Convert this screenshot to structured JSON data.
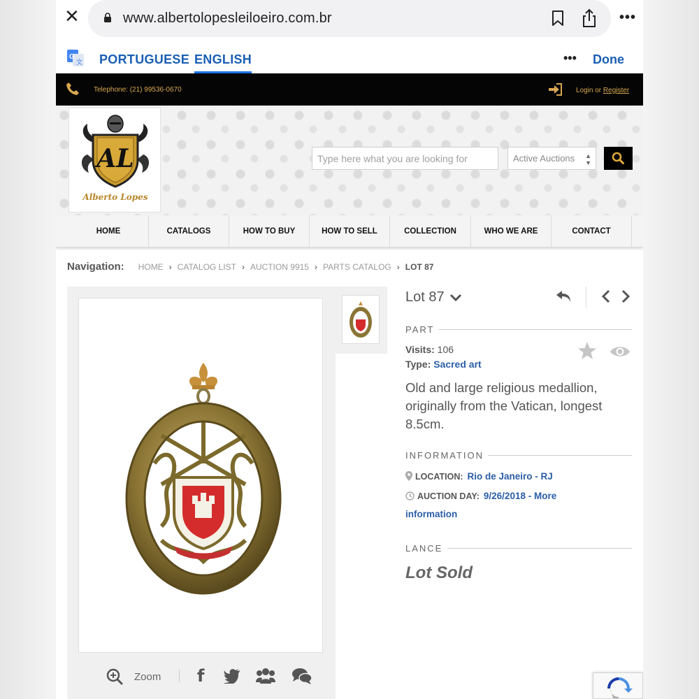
{
  "browser": {
    "url": "www.albertolopesleiloeiro.com.br"
  },
  "translate": {
    "lang_source": "PORTUGUESE",
    "lang_target": "ENGLISH",
    "done_label": "Done",
    "more_label": "•••"
  },
  "topbar": {
    "telephone": "Telephone: (21) 99536-0670",
    "login_text": "Login or ",
    "register_label": "Register"
  },
  "header": {
    "logo_monogram": "AL",
    "logo_name": "Alberto Lopes",
    "search_placeholder": "Type here what you are looking for",
    "auction_select_value": "Active Auctions"
  },
  "nav": {
    "items": [
      "HOME",
      "CATALOGS",
      "HOW TO BUY",
      "HOW TO SELL",
      "COLLECTION",
      "WHO WE ARE",
      "CONTACT"
    ]
  },
  "breadcrumb": {
    "label": "Navigation:",
    "items": [
      "HOME",
      "CATALOG LIST",
      "AUCTION 9915",
      "PARTS CATALOG"
    ],
    "current": "LOT 87"
  },
  "gallery": {
    "zoom_label": "Zoom"
  },
  "lot": {
    "title": "Lot 87",
    "part_section": "PART",
    "visits_label": "Visits:",
    "visits_value": "106",
    "type_label": "Type:",
    "type_value": "Sacred art",
    "description": "Old and large religious medallion, originally from the Vatican, longest 8.5cm.",
    "info_section": "INFORMATION",
    "location_label": "LOCATION:",
    "location_value": "Rio de Janeiro - RJ",
    "auction_day_label": "AUCTION DAY:",
    "auction_day_value": "9/26/2018 - More",
    "auction_day_value2": "information",
    "lance_section": "LANCE",
    "status": "Lot Sold"
  },
  "colors": {
    "accent_gold": "#d7a850",
    "link_blue": "#2b5ea7",
    "translate_blue": "#1a5fb4"
  }
}
